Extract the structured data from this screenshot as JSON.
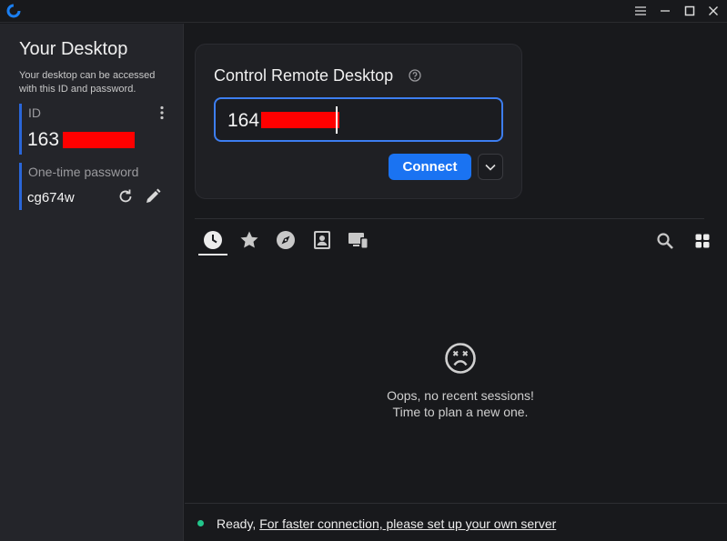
{
  "window": {
    "menu_icon": "hamburger-icon",
    "minimize_icon": "minimize-icon",
    "maximize_icon": "maximize-icon",
    "close_icon": "close-icon"
  },
  "sidebar": {
    "title": "Your Desktop",
    "description": "Your desktop can be accessed with this ID and password.",
    "id_label": "ID",
    "id_value": "163",
    "password_label": "One-time password",
    "password_value": "cg674w"
  },
  "control": {
    "title": "Control Remote Desktop",
    "input_value": "164",
    "connect_label": "Connect"
  },
  "tabs": [
    {
      "name": "recent-sessions-tab",
      "icon": "clock-icon",
      "active": true
    },
    {
      "name": "favorites-tab",
      "icon": "star-icon",
      "active": false
    },
    {
      "name": "discovered-tab",
      "icon": "compass-icon",
      "active": false
    },
    {
      "name": "address-book-tab",
      "icon": "contact-icon",
      "active": false
    },
    {
      "name": "lan-peers-tab",
      "icon": "devices-icon",
      "active": false
    }
  ],
  "empty_state": {
    "line1": "Oops, no recent sessions!",
    "line2": "Time to plan a new one."
  },
  "status": {
    "ready_text": "Ready,",
    "link_text": "For faster connection, please set up your own server"
  },
  "colors": {
    "accent": "#1a73f2",
    "focus_border": "#3d7ef0",
    "status_ok": "#22c58b",
    "redaction": "#ff0000"
  }
}
